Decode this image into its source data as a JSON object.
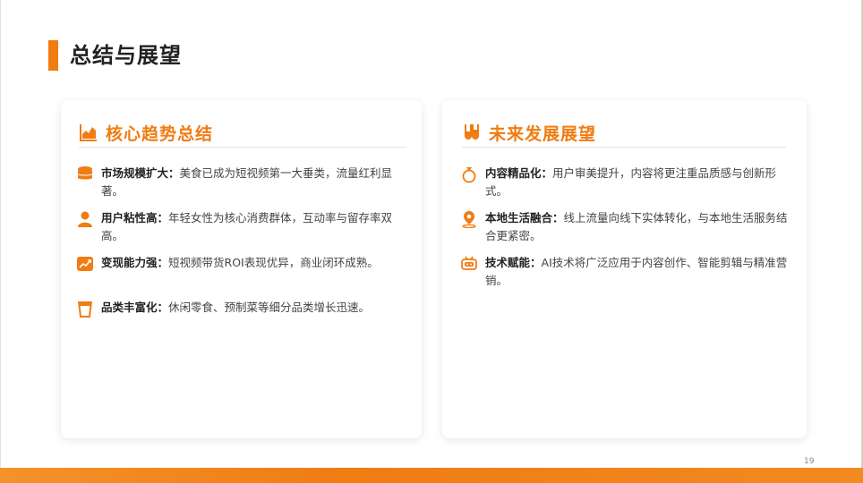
{
  "page": {
    "title": "总结与展望",
    "page_number": "19",
    "accent_color": "#f07c12"
  },
  "left_card": {
    "title": "核心趋势总结",
    "icon": "area-chart-icon",
    "items": [
      {
        "icon": "coins-stack-icon",
        "label": "市场规模扩大：",
        "text": "美食已成为短视频第一大垂类，流量红利显著。"
      },
      {
        "icon": "user-icon",
        "label": "用户粘性高：",
        "text": "年轻女性为核心消费群体，互动率与留存率双高。"
      },
      {
        "icon": "trend-chart-icon",
        "label": "变现能力强：",
        "text": "短视频带货ROI表现优异，商业闭环成熟。"
      },
      {
        "icon": "cup-icon",
        "label": "品类丰富化：",
        "text": "休闲零食、预制菜等细分品类增长迅速。"
      }
    ]
  },
  "right_card": {
    "title": "未来发展展望",
    "icon": "test-tubes-icon",
    "items": [
      {
        "icon": "ring-icon",
        "label": "内容精品化：",
        "text": "用户审美提升，内容将更注重品质感与创新形式。"
      },
      {
        "icon": "map-pin-icon",
        "label": "本地生活融合：",
        "text": "线上流量向线下实体转化，与本地生活服务结合更紧密。"
      },
      {
        "icon": "robot-icon",
        "label": "技术赋能：",
        "text": "AI技术将广泛应用于内容创作、智能剪辑与精准营销。"
      }
    ]
  }
}
